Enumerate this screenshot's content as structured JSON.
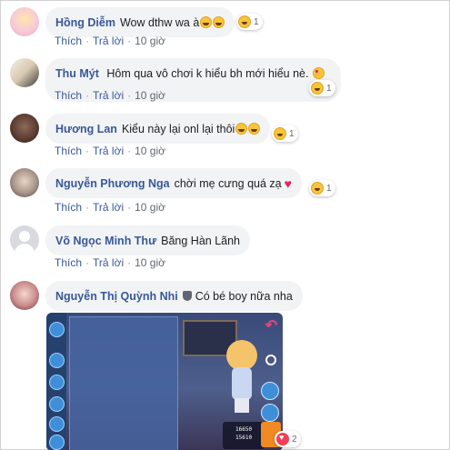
{
  "comments": [
    {
      "name": "Hồng Diễm",
      "text": "Wow dthw wa à",
      "emojis": [
        "grinning-squint-icon",
        "grinning-squint-icon"
      ],
      "reaction_count": "1",
      "actions": {
        "like": "Thích",
        "reply": "Trả lời",
        "time": "10 giờ"
      }
    },
    {
      "name": "Thu Mýt",
      "text": "Hôm qua vô chơi k hiểu bh mới hiểu nè.",
      "emojis": [
        "heart-eyes-icon"
      ],
      "reaction_count": "1",
      "actions": {
        "like": "Thích",
        "reply": "Trả lời",
        "time": "10 giờ"
      }
    },
    {
      "name": "Hương Lan",
      "text": "Kiểu này lại onl lại thôi",
      "emojis": [
        "grinning-squint-icon",
        "grinning-squint-icon"
      ],
      "reaction_count": "1",
      "actions": {
        "like": "Thích",
        "reply": "Trả lời",
        "time": "10 giờ"
      }
    },
    {
      "name": "Nguyễn Phương Nga",
      "text": "chời mẹ cưng quá zạ",
      "emojis": [
        "red-heart-icon"
      ],
      "reaction_count": "1",
      "actions": {
        "like": "Thích",
        "reply": "Trả lời",
        "time": "10 giờ"
      }
    },
    {
      "name": "Võ Ngọc Minh Thư",
      "text": "Băng Hàn Lãnh",
      "emojis": [],
      "reaction_count": "",
      "actions": {
        "like": "Thích",
        "reply": "Trả lời",
        "time": "10 giờ"
      }
    },
    {
      "name": "Nguyễn Thị Quỳnh Nhi",
      "text": "Có bé boy nữa nha",
      "emojis": [],
      "reaction_count": "2",
      "actions": {
        "like": "",
        "reply": "",
        "time": ""
      }
    }
  ],
  "dot": "·",
  "image_attachment": {
    "description_icon": "game-screenshot",
    "stats": [
      "16650",
      "15610"
    ]
  },
  "colors": {
    "name_link": "#385898",
    "bubble_bg": "#f2f3f5",
    "meta": "#606770"
  }
}
